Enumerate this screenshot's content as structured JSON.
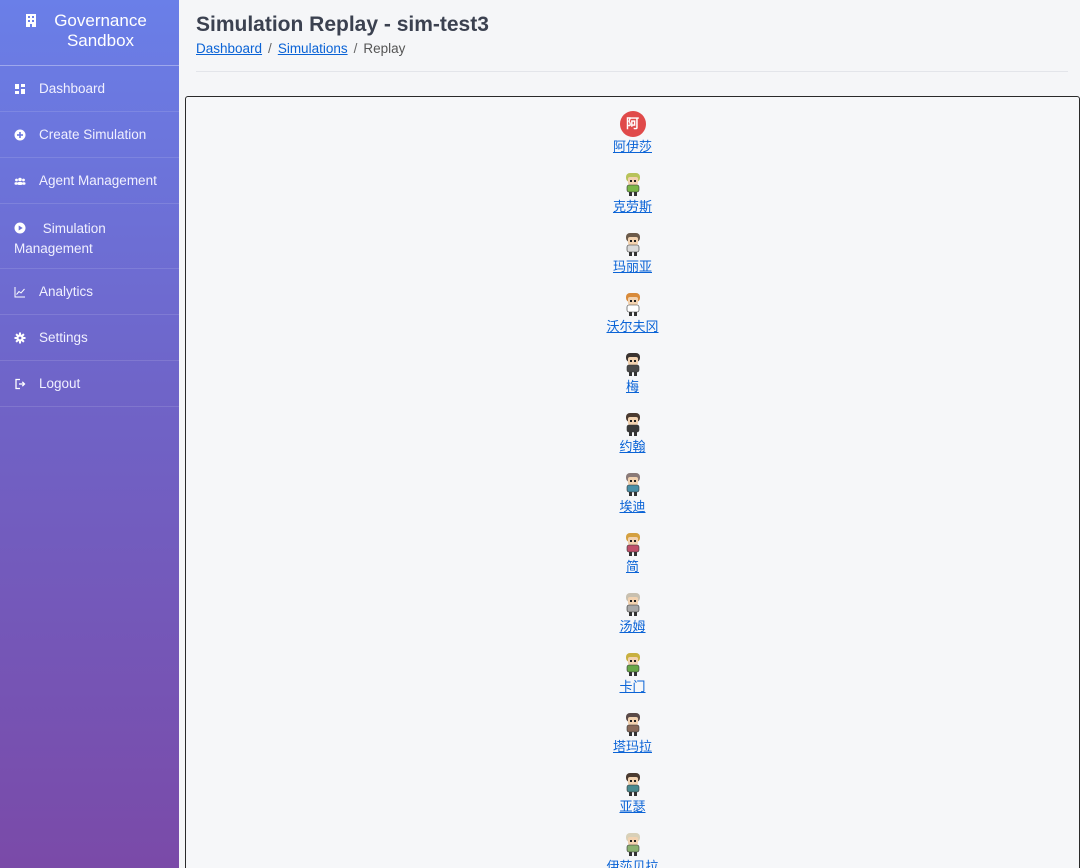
{
  "sidebar": {
    "brand": "Governance Sandbox",
    "items": [
      {
        "label": "Dashboard",
        "icon": "dashboard-icon"
      },
      {
        "label": "Create Simulation",
        "icon": "plus-circle-icon"
      },
      {
        "label": "Agent Management",
        "icon": "users-icon"
      },
      {
        "label": "Simulation Management",
        "icon": "play-circle-icon"
      },
      {
        "label": "Analytics",
        "icon": "line-chart-icon"
      },
      {
        "label": "Settings",
        "icon": "gear-icon"
      },
      {
        "label": "Logout",
        "icon": "logout-icon"
      }
    ]
  },
  "header": {
    "title": "Simulation Replay - sim-test3",
    "breadcrumb": {
      "dashboard": "Dashboard",
      "simulations": "Simulations",
      "current": "Replay"
    }
  },
  "agents": [
    {
      "name": "阿伊莎",
      "badge": "阿",
      "hair": "#e04a4a",
      "shirt": "#e04a4a"
    },
    {
      "name": "克劳斯",
      "hair": "#b8c35a",
      "shirt": "#7ab648"
    },
    {
      "name": "玛丽亚",
      "hair": "#6b5a4a",
      "shirt": "#d9d9d9"
    },
    {
      "name": "沃尔夫冈",
      "hair": "#d88a3a",
      "shirt": "#ffffff"
    },
    {
      "name": "梅",
      "hair": "#3a3330",
      "shirt": "#4a4a4a"
    },
    {
      "name": "约翰",
      "hair": "#4a3a30",
      "shirt": "#3a3a3a"
    },
    {
      "name": "埃迪",
      "hair": "#8a7a78",
      "shirt": "#4a90a8"
    },
    {
      "name": "简",
      "hair": "#d4a040",
      "shirt": "#c0506a"
    },
    {
      "name": "汤姆",
      "hair": "#c8c0b0",
      "shirt": "#a8a8a8"
    },
    {
      "name": "卡门",
      "hair": "#c8b040",
      "shirt": "#68a848"
    },
    {
      "name": "塔玛拉",
      "hair": "#5a4a48",
      "shirt": "#8a6a5a"
    },
    {
      "name": "亚瑟",
      "hair": "#4a3a30",
      "shirt": "#4a8a90"
    },
    {
      "name": "伊莎贝拉",
      "hair": "#d8d0b8",
      "shirt": "#8ab070"
    }
  ]
}
